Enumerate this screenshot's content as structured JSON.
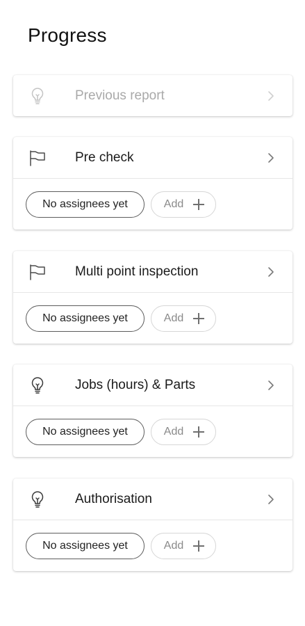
{
  "header": {
    "title": "Progress"
  },
  "cards": [
    {
      "id": "previous-report",
      "title": "Previous report",
      "icon": "lightbulb-icon",
      "disabled": true,
      "has_footer": false
    },
    {
      "id": "pre-check",
      "title": "Pre check",
      "icon": "flag-icon",
      "disabled": false,
      "has_footer": true,
      "assignees_label": "No assignees yet",
      "add_label": "Add"
    },
    {
      "id": "multi-point-inspection",
      "title": "Multi point inspection",
      "icon": "flag-icon",
      "disabled": false,
      "has_footer": true,
      "assignees_label": "No assignees yet",
      "add_label": "Add"
    },
    {
      "id": "jobs-parts",
      "title": "Jobs (hours) & Parts",
      "icon": "lightbulb-icon",
      "disabled": false,
      "has_footer": true,
      "assignees_label": "No assignees yet",
      "add_label": "Add"
    },
    {
      "id": "authorisation",
      "title": "Authorisation",
      "icon": "lightbulb-icon",
      "disabled": false,
      "has_footer": true,
      "assignees_label": "No assignees yet",
      "add_label": "Add"
    }
  ],
  "colors": {
    "text": "#1a1a1a",
    "disabled_text": "#a9a9a9",
    "border": "#e6e6e6"
  }
}
